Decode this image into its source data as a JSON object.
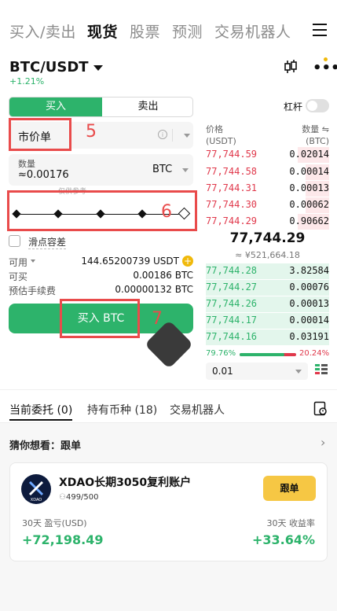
{
  "nav": {
    "tabs": [
      "买入/卖出",
      "现货",
      "股票",
      "预测",
      "交易机器人"
    ],
    "active_index": 1
  },
  "pair": {
    "symbol": "BTC/USDT",
    "change": "+1.21%"
  },
  "order_form": {
    "buy_label": "买入",
    "sell_label": "卖出",
    "leverage_label": "杠杆",
    "order_type": "市价单",
    "quantity_label": "数量",
    "quantity_value": "≈0.00176",
    "quantity_unit": "BTC",
    "slider_hint": "仅供参考",
    "slippage_label": "滑点容差",
    "available_label": "可用",
    "available_value": "144.65200739 USDT",
    "can_buy_label": "可买",
    "can_buy_value": "0.00186 BTC",
    "fee_label": "预估手续费",
    "fee_value": "0.00000132 BTC",
    "submit_label": "买入 BTC"
  },
  "annotations": {
    "a5": "5",
    "a6": "6",
    "a7": "7"
  },
  "orderbook": {
    "price_header": "价格",
    "price_unit": "(USDT)",
    "qty_header": "数量 ⇋",
    "qty_unit": "(BTC)",
    "asks": [
      {
        "price": "77,744.59",
        "qty": "0.02014"
      },
      {
        "price": "77,744.58",
        "qty": "0.00014"
      },
      {
        "price": "77,744.31",
        "qty": "0.00013"
      },
      {
        "price": "77,744.30",
        "qty": "0.00062"
      },
      {
        "price": "77,744.29",
        "qty": "0.90662"
      }
    ],
    "last_price": "77,744.29",
    "last_price_cny": "≈ ¥521,664.18",
    "bids": [
      {
        "price": "77,744.28",
        "qty": "3.82584"
      },
      {
        "price": "77,744.27",
        "qty": "0.00076"
      },
      {
        "price": "77,744.26",
        "qty": "0.00013"
      },
      {
        "price": "77,744.17",
        "qty": "0.00014"
      },
      {
        "price": "77,744.16",
        "qty": "0.03191"
      }
    ],
    "buy_ratio": "79.76%",
    "sell_ratio": "20.24%",
    "buy_ratio_value": 0.7976,
    "precision": "0.01"
  },
  "bottom_tabs": {
    "open_orders": "当前委托 (0)",
    "holdings": "持有币种 (18)",
    "bots": "交易机器人"
  },
  "copy_section": {
    "title": "猜你想看：跟单",
    "card": {
      "name": "XDAO长期3050复利账户",
      "followers": "499/500",
      "follow_label": "跟单",
      "pnl_label": "30天 盈亏(USD)",
      "pnl_value": "+72,198.49",
      "roi_label": "30天 收益率",
      "roi_value": "+33.64%"
    }
  },
  "colors": {
    "green": "#2db36b",
    "red": "#e0384b",
    "annotation": "#e94b4b",
    "follow_button": "#f6c744"
  }
}
